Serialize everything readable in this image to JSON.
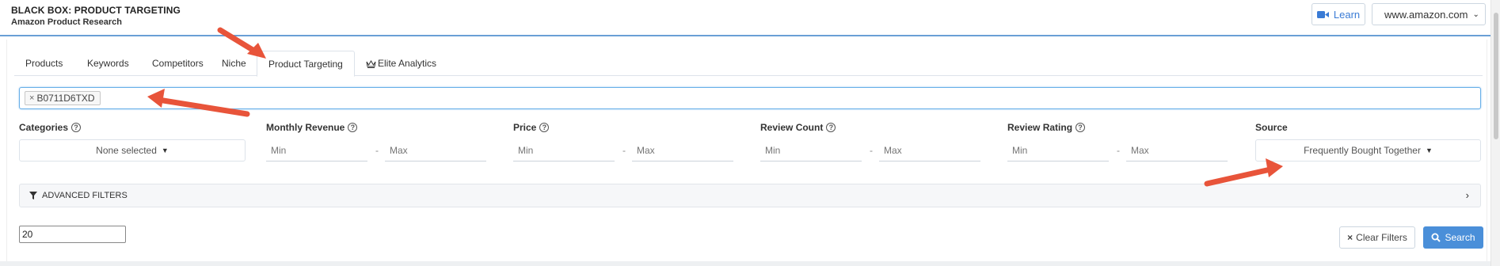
{
  "header": {
    "title": "BLACK BOX: PRODUCT TARGETING",
    "subtitle": "Amazon Product Research",
    "learn_label": "Learn",
    "marketplace": "www.amazon.com"
  },
  "tabs": [
    {
      "label": "Products",
      "active": false
    },
    {
      "label": "Keywords",
      "active": false
    },
    {
      "label": "Competitors",
      "active": false
    },
    {
      "label": "Niche",
      "active": false
    },
    {
      "label": "Product Targeting",
      "active": true
    },
    {
      "label": "Elite Analytics",
      "active": false
    }
  ],
  "asin_input": {
    "tags": [
      "B0711D6TXD"
    ]
  },
  "filters": {
    "categories": {
      "label": "Categories",
      "value": "None selected"
    },
    "monthly_revenue": {
      "label": "Monthly Revenue",
      "min_placeholder": "Min",
      "max_placeholder": "Max"
    },
    "price": {
      "label": "Price",
      "min_placeholder": "Min",
      "max_placeholder": "Max"
    },
    "review_count": {
      "label": "Review Count",
      "min_placeholder": "Min",
      "max_placeholder": "Max"
    },
    "review_rating": {
      "label": "Review Rating",
      "min_placeholder": "Min",
      "max_placeholder": "Max"
    },
    "source": {
      "label": "Source",
      "value": "Frequently Bought Together"
    },
    "dash": "-"
  },
  "advanced_filters": {
    "label": "ADVANCED FILTERS"
  },
  "results_limit": {
    "value": "20"
  },
  "actions": {
    "clear_label": "Clear Filters",
    "search_label": "Search"
  },
  "colors": {
    "accent": "#4a8fd9",
    "annotation_arrow": "#e8543a",
    "header_border": "#6a9fd6"
  }
}
